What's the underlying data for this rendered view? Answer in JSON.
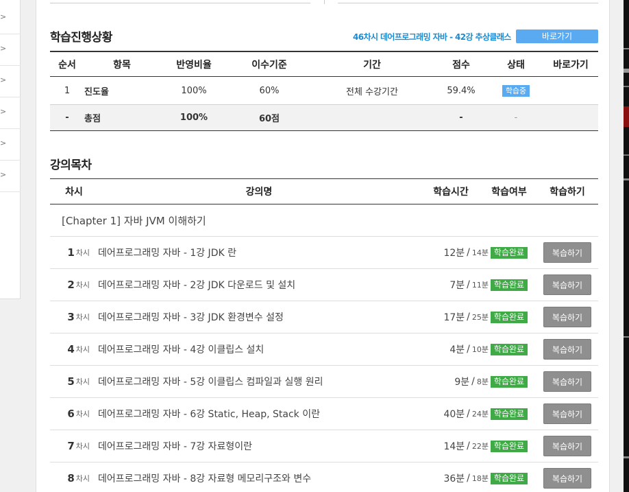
{
  "sidebar": {
    "items": [
      ">",
      ">",
      ">",
      ">",
      ">",
      ">"
    ]
  },
  "progress": {
    "title": "학습진행상황",
    "course_link": "46차시 데어프로그래밍 자바 - 42강 추상클래스",
    "goto_label": "바로가기",
    "headers": [
      "순서",
      "항목",
      "반영비율",
      "이수기준",
      "기간",
      "점수",
      "상태",
      "바로가기"
    ],
    "rows": [
      {
        "no": "1",
        "item": "진도율",
        "ratio": "100%",
        "criteria": "60%",
        "period": "전체 수강기간",
        "score": "59.4%",
        "status": "학습중",
        "link": ""
      }
    ],
    "total": {
      "no": "-",
      "item": "총점",
      "ratio": "100%",
      "criteria": "60점",
      "period": "",
      "score": "-",
      "status": "-",
      "link": ""
    }
  },
  "lectures": {
    "title": "강의목차",
    "headers": [
      "차시",
      "강의명",
      "학습시간",
      "학습여부",
      "학습하기"
    ],
    "chapter": "[Chapter 1] 자바 JVM 이해하기",
    "unit_label": "차시",
    "time_sep": "/",
    "done_label": "학습완료",
    "review_label": "복습하기",
    "rows": [
      {
        "no": "1",
        "title": "데어프로그래밍 자바 - 1강 JDK 란",
        "time": "12분",
        "total": "14분"
      },
      {
        "no": "2",
        "title": "데어프로그래밍 자바 - 2강 JDK 다운로드 및 설치",
        "time": "7분",
        "total": "11분"
      },
      {
        "no": "3",
        "title": "데어프로그래밍 자바 - 3강 JDK 환경변수 설정",
        "time": "17분",
        "total": "25분"
      },
      {
        "no": "4",
        "title": "데어프로그래밍 자바 - 4강 이클립스 설치",
        "time": "4분",
        "total": "10분"
      },
      {
        "no": "5",
        "title": "데어프로그래밍 자바 - 5강 이클립스 컴파일과 실행 원리",
        "time": "9분",
        "total": "8분"
      },
      {
        "no": "6",
        "title": "데어프로그래밍 자바 - 6강 Static, Heap, Stack 이란",
        "time": "40분",
        "total": "24분"
      },
      {
        "no": "7",
        "title": "데어프로그래밍 자바 - 7강 자료형이란",
        "time": "14분",
        "total": "22분"
      },
      {
        "no": "8",
        "title": "데어프로그래밍 자바 - 8강 자료형 메모리구조와 변수",
        "time": "36분",
        "total": "18분"
      }
    ]
  },
  "colors": {
    "accent_blue": "#5aaaf2",
    "link_blue": "#1b8bd0",
    "done_green": "#3faa46",
    "review_gray": "#8f8f8f"
  }
}
